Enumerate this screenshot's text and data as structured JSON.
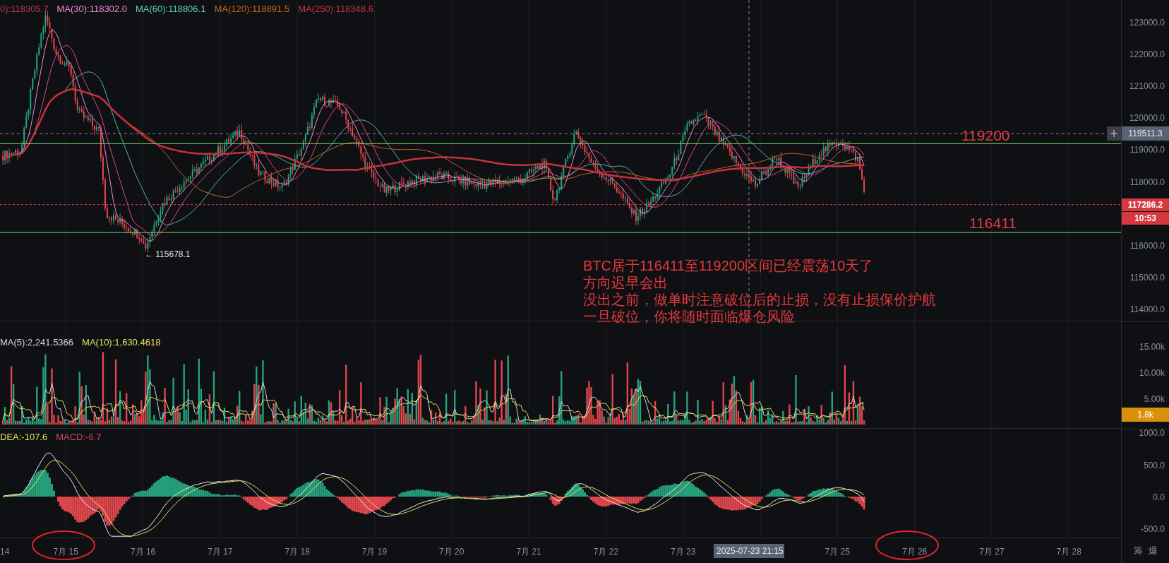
{
  "price_pane": {
    "legend": [
      {
        "text": "0):118305.7",
        "color": "#b8374f"
      },
      {
        "text": "MA(30):118302.0",
        "color": "#f08ad0"
      },
      {
        "text": "MA(60):118806.1",
        "color": "#5fd0c0"
      },
      {
        "text": "MA(120):118891.5",
        "color": "#c0651f"
      },
      {
        "text": "MA(250):118348.6",
        "color": "#c8323c"
      }
    ],
    "low_marker": "← 115678.1",
    "levels": [
      {
        "label": "119200"
      },
      {
        "label": "116411"
      }
    ],
    "note": [
      "BTC居于116411至119200区间已经震荡10天了",
      "方向迟早会出",
      "没出之前，做单时注意破位后的止损，没有止损保价护航",
      "一旦破位，你将随时面临爆仓风险"
    ],
    "axis_ticks": [
      "123000.0",
      "122000.0",
      "121000.0",
      "120000.0",
      "119000.0",
      "118000.0",
      "116000.0",
      "115000.0",
      "114000.0"
    ],
    "crosshair_price": "119511.3",
    "last_price": "117286.2",
    "countdown": "10:53"
  },
  "volume_pane": {
    "legend": [
      {
        "text": "MA(5):2,241.5366",
        "color": "#d4d4d4"
      },
      {
        "text": "MA(10):1,630.4618",
        "color": "#e8e05a"
      }
    ],
    "axis_ticks": [
      "15.00k",
      "10.00k",
      "5.00k"
    ],
    "current": "1.8k"
  },
  "macd_pane": {
    "legend": [
      {
        "text": "DEA:-107.6",
        "color": "#e8e05a"
      },
      {
        "text": "MACD:-6.7",
        "color": "#c84a5a"
      }
    ],
    "axis_ticks": [
      "1000.0",
      "500.0",
      "0.0",
      "-500.0"
    ]
  },
  "time_axis": {
    "labels": [
      {
        "text": "14",
        "kind": "date"
      },
      {
        "text": "7月 15",
        "kind": "date"
      },
      {
        "text": "7月 16",
        "kind": "date"
      },
      {
        "text": "7月 17",
        "kind": "date"
      },
      {
        "text": "7月 18",
        "kind": "date"
      },
      {
        "text": "7月 19",
        "kind": "date"
      },
      {
        "text": "7月 20",
        "kind": "date"
      },
      {
        "text": "7月 21",
        "kind": "date"
      },
      {
        "text": "7月 22",
        "kind": "date"
      },
      {
        "text": "7月 23",
        "kind": "date"
      },
      {
        "text": "2025-07-23 21:15",
        "kind": "crosshair"
      },
      {
        "text": "7月 25",
        "kind": "date"
      },
      {
        "text": "7月 26",
        "kind": "date"
      },
      {
        "text": "7月 27",
        "kind": "date"
      },
      {
        "text": "7月 28",
        "kind": "date"
      }
    ],
    "buttons": [
      "筹",
      "爆"
    ]
  }
}
